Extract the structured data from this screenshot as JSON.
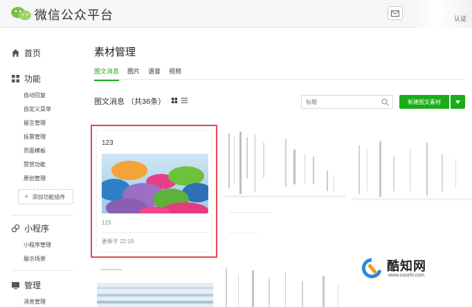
{
  "header": {
    "brand": "微信公众平台",
    "account_tag": "认证"
  },
  "sidebar": {
    "home": "首页",
    "function": {
      "label": "功能",
      "items": [
        "自动回复",
        "自定义菜单",
        "留言管理",
        "投票管理",
        "页面模板",
        "赞赏功能",
        "原创管理"
      ],
      "add_plugin": "添加功能插件"
    },
    "miniprogram": {
      "label": "小程序",
      "items": [
        "小程序管理",
        "展示场景"
      ]
    },
    "manage": {
      "label": "管理",
      "items": [
        "消息管理"
      ]
    }
  },
  "main": {
    "title": "素材管理",
    "tabs": [
      {
        "label": "图文消息",
        "active": true
      },
      {
        "label": "图片",
        "active": false
      },
      {
        "label": "语音",
        "active": false
      },
      {
        "label": "视频",
        "active": false
      }
    ],
    "list_title": "图文消息 （共36条）",
    "search_placeholder": "标题",
    "new_button": "新建图文素材",
    "card": {
      "title": "123",
      "caption": "123",
      "updated": "更新于 22:19"
    }
  },
  "watermark": {
    "text": "酷知网",
    "url": "www.coozhi.com"
  },
  "colors": {
    "accent": "#1aad19",
    "highlight_border": "#e0474b"
  }
}
